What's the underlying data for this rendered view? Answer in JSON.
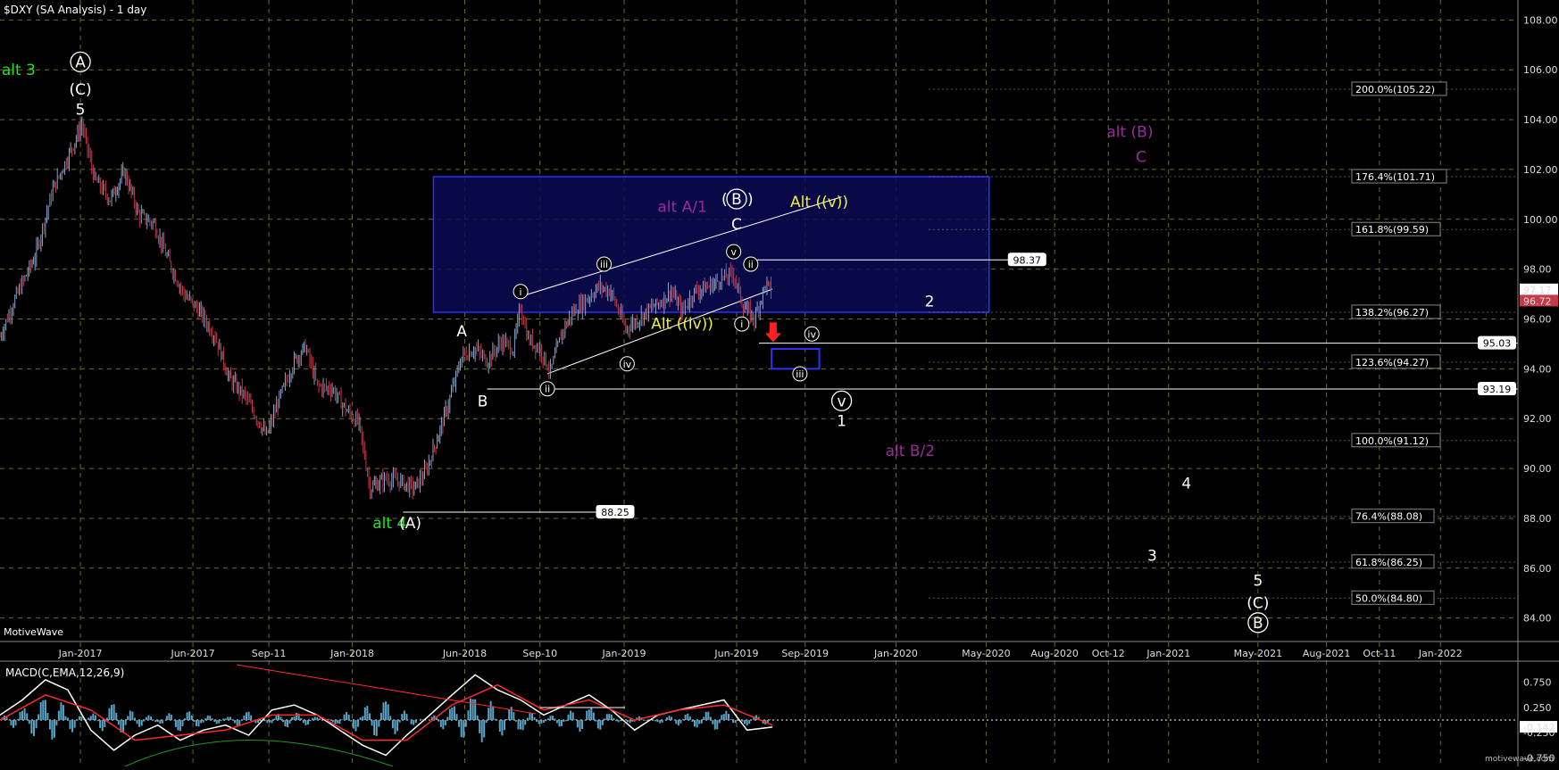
{
  "window": {
    "title": "$DXY (SA Analysis) - 1 day",
    "watermark": "MotiveWave",
    "footer_brand": "motivewave.com"
  },
  "colors": {
    "background": "#000000",
    "grid": "#6b6b2a",
    "price_up": "#8aa3c8",
    "price_down": "#c23b4a",
    "box_fill": "#0b0b55",
    "box_stroke": "#2f2fff",
    "line_white": "#ffffff",
    "label_green": "#22e622",
    "label_purple": "#9b2a9b",
    "label_yellow": "#f3f03a",
    "arrow_red": "#ff2020",
    "macd_line": "#ffffff",
    "macd_signal": "#ff2a2a",
    "macd_hist": "#5aa5c8",
    "macd_arc": "#1f9b1f"
  },
  "chart_data": [
    {
      "type": "line",
      "title": "$DXY (SA Analysis) - 1 day",
      "x_tick_labels": [
        "Jan-2017",
        "Jun-2017",
        "Sep-11",
        "Jan-2018",
        "Jun-2018",
        "Sep-10",
        "Jan-2019",
        "Jun-2019",
        "Sep-2019",
        "Jan-2020",
        "May-2020",
        "Aug-2020",
        "Oct-12",
        "Jan-2021",
        "May-2021",
        "Aug-2021",
        "Oct-11",
        "Jan-2022"
      ],
      "x_tick_dates": [
        "2017-01-01",
        "2017-06-01",
        "2017-09-11",
        "2018-01-01",
        "2018-06-01",
        "2018-09-10",
        "2019-01-01",
        "2019-06-01",
        "2019-09-01",
        "2020-01-01",
        "2020-05-01",
        "2020-08-01",
        "2020-10-12",
        "2021-01-01",
        "2021-05-01",
        "2021-08-01",
        "2021-10-11",
        "2022-01-01"
      ],
      "x_range": [
        "2016-09-15",
        "2022-04-15"
      ],
      "y_ticks": [
        84,
        86,
        88,
        90,
        92,
        94,
        96,
        98,
        100,
        102,
        104,
        106,
        108
      ],
      "y_tick_labels": [
        "84.00",
        "86.00",
        "88.00",
        "90.00",
        "92.00",
        "94.00",
        "96.00",
        "98.00",
        "100.00",
        "102.00",
        "104.00",
        "106.00",
        "108.00"
      ],
      "ylim": [
        83.2,
        108.8
      ],
      "grid": true,
      "series": [
        {
          "x": [
            "2016-09-15",
            "2016-10-05",
            "2016-11-01",
            "2016-11-25",
            "2016-12-15",
            "2017-01-03",
            "2017-01-20",
            "2017-02-10",
            "2017-03-01",
            "2017-03-20",
            "2017-04-10",
            "2017-05-01",
            "2017-05-20",
            "2017-06-10",
            "2017-07-01",
            "2017-07-20",
            "2017-08-10",
            "2017-09-08",
            "2017-09-25",
            "2017-10-15",
            "2017-10-30",
            "2017-11-15",
            "2017-12-05",
            "2017-12-25",
            "2018-01-10",
            "2018-01-25",
            "2018-02-15",
            "2018-03-05",
            "2018-03-25",
            "2018-04-10",
            "2018-04-25",
            "2018-05-10",
            "2018-05-28",
            "2018-06-15",
            "2018-07-01",
            "2018-07-20",
            "2018-08-05",
            "2018-08-15",
            "2018-08-25",
            "2018-09-10",
            "2018-09-24",
            "2018-10-10",
            "2018-10-25",
            "2018-11-12",
            "2018-11-28",
            "2018-12-14",
            "2019-01-03",
            "2019-01-20",
            "2019-02-05",
            "2019-02-20",
            "2019-03-05",
            "2019-03-20",
            "2019-04-05",
            "2019-04-25",
            "2019-05-10",
            "2019-05-28",
            "2019-06-10",
            "2019-06-25",
            "2019-07-10",
            "2019-07-19"
          ],
          "y": [
            95.3,
            96.8,
            98.5,
            101.2,
            102.5,
            103.8,
            101.6,
            100.8,
            101.9,
            100.2,
            99.8,
            98.2,
            97.0,
            96.3,
            95.3,
            93.6,
            92.9,
            91.3,
            92.8,
            94.3,
            94.9,
            93.3,
            93.2,
            92.3,
            91.8,
            89.2,
            89.6,
            89.5,
            89.2,
            89.9,
            91.2,
            92.6,
            94.5,
            94.8,
            94.3,
            95.1,
            94.8,
            96.5,
            95.2,
            94.8,
            93.9,
            95.5,
            96.3,
            96.8,
            97.3,
            97.1,
            95.6,
            96.0,
            96.4,
            96.7,
            97.1,
            96.3,
            97.1,
            97.3,
            97.6,
            97.8,
            96.5,
            96.0,
            97.4,
            97.1
          ]
        }
      ],
      "wave_labels": [
        {
          "text": "alt 3",
          "x": "2016-10-10",
          "y": 105.8,
          "color": "green"
        },
        {
          "text": "A",
          "x": "2017-01-01",
          "y": 106.1,
          "style": "circled",
          "color": "white"
        },
        {
          "text": "(C)",
          "x": "2017-01-01",
          "y": 105.0,
          "color": "white"
        },
        {
          "text": "5",
          "x": "2017-01-01",
          "y": 104.2,
          "color": "white"
        },
        {
          "text": "alt 4",
          "x": "2018-02-20",
          "y": 87.6,
          "color": "green"
        },
        {
          "text": "(A)",
          "x": "2018-03-20",
          "y": 87.6,
          "color": "white"
        },
        {
          "text": "A",
          "x": "2018-05-28",
          "y": 95.3,
          "color": "white"
        },
        {
          "text": "B",
          "x": "2018-06-25",
          "y": 92.5,
          "color": "white"
        },
        {
          "text": "alt A/1",
          "x": "2019-03-20",
          "y": 100.3,
          "color": "purple"
        },
        {
          "text": "B",
          "x": "2019-06-01",
          "y": 100.6,
          "style": "paren-circled",
          "color": "white"
        },
        {
          "text": "C",
          "x": "2019-06-01",
          "y": 99.6,
          "color": "white"
        },
        {
          "text": "Alt ((v))",
          "x": "2019-09-20",
          "y": 100.5,
          "color": "yellow"
        },
        {
          "text": "Alt ((iv))",
          "x": "2019-03-20",
          "y": 95.6,
          "color": "yellow"
        },
        {
          "text": "2",
          "x": "2020-02-15",
          "y": 96.5,
          "color": "white"
        },
        {
          "text": "alt (B)",
          "x": "2020-11-10",
          "y": 103.3,
          "color": "purple"
        },
        {
          "text": "C",
          "x": "2020-11-25",
          "y": 102.3,
          "color": "purple"
        },
        {
          "text": "v",
          "x": "2019-10-20",
          "y": 92.5,
          "style": "circled",
          "color": "white"
        },
        {
          "text": "1",
          "x": "2019-10-20",
          "y": 91.7,
          "color": "white"
        },
        {
          "text": "alt B/2",
          "x": "2020-01-20",
          "y": 90.5,
          "color": "purple"
        },
        {
          "text": "4",
          "x": "2021-01-25",
          "y": 89.2,
          "color": "white"
        },
        {
          "text": "3",
          "x": "2020-12-10",
          "y": 86.3,
          "color": "white"
        },
        {
          "text": "5",
          "x": "2021-05-01",
          "y": 85.3,
          "color": "white"
        },
        {
          "text": "(C)",
          "x": "2021-05-01",
          "y": 84.4,
          "color": "white"
        },
        {
          "text": "B",
          "x": "2021-05-01",
          "y": 83.6,
          "style": "circled",
          "color": "white"
        }
      ],
      "minor_labels": [
        {
          "text": "i",
          "x": "2018-08-15",
          "y": 97.1
        },
        {
          "text": "ii",
          "x": "2018-09-20",
          "y": 93.2
        },
        {
          "text": "iii",
          "x": "2018-12-05",
          "y": 98.2
        },
        {
          "text": "iv",
          "x": "2019-01-05",
          "y": 94.2
        },
        {
          "text": "v",
          "x": "2019-05-28",
          "y": 98.7
        },
        {
          "text": "ii",
          "x": "2019-06-20",
          "y": 98.2
        },
        {
          "text": "i",
          "x": "2019-06-08",
          "y": 95.8
        },
        {
          "text": "iv",
          "x": "2019-09-10",
          "y": 95.4
        },
        {
          "text": "iii",
          "x": "2019-08-25",
          "y": 93.8
        }
      ],
      "horizontal_levels": [
        {
          "label": "98.37",
          "value": 98.37,
          "x_start": "2019-06-20",
          "x_end": "2020-06-25"
        },
        {
          "label": "95.03",
          "value": 95.03,
          "x_start": "2019-07-01",
          "x_end": "2022-04-15"
        },
        {
          "label": "93.19",
          "value": 93.19,
          "x_start": "2018-07-01",
          "x_end": "2022-04-15"
        },
        {
          "label": "88.25",
          "value": 88.25,
          "x_start": "2018-03-10",
          "x_end": "2018-12-20"
        }
      ],
      "fib_levels": [
        {
          "label": "200.0%(105.22)",
          "value": 105.22
        },
        {
          "label": "176.4%(101.71)",
          "value": 101.71
        },
        {
          "label": "161.8%(99.59)",
          "value": 99.59
        },
        {
          "label": "138.2%(96.27)",
          "value": 96.27
        },
        {
          "label": "123.6%(94.27)",
          "value": 94.27
        },
        {
          "label": "100.0%(91.12)",
          "value": 91.12
        },
        {
          "label": "76.4%(88.08)",
          "value": 88.08
        },
        {
          "label": "61.8%(86.25)",
          "value": 86.25
        },
        {
          "label": "50.0%(84.80)",
          "value": 84.8
        }
      ],
      "target_boxes": [
        {
          "x0": "2018-04-20",
          "x1": "2020-05-05",
          "y0": 96.27,
          "y1": 101.71
        },
        {
          "x0": "2019-07-18",
          "x1": "2019-09-20",
          "y0": 94.0,
          "y1": 94.8
        }
      ],
      "channel_lines": [
        {
          "x0": "2018-08-15",
          "y0": 96.9,
          "x1": "2019-10-20",
          "y1": 100.9
        },
        {
          "x0": "2018-09-20",
          "y0": 93.8,
          "x1": "2019-07-19",
          "y1": 97.2
        }
      ],
      "price_tags": [
        {
          "label": "97.17",
          "value": 97.17,
          "kind": "last-close"
        },
        {
          "label": "96.72",
          "value": 96.72,
          "kind": "current"
        }
      ],
      "arrow": {
        "direction": "down",
        "x": "2019-07-20",
        "y": 95.0
      }
    },
    {
      "type": "line",
      "title": "MACD(C,EMA,12,26,9)",
      "ylim": [
        -0.85,
        1.1
      ],
      "y_ticks": [
        0.75,
        0.25,
        -0.25,
        -0.75
      ],
      "y_tick_labels": [
        "0.750",
        "0.250",
        "-0.250",
        "-0.750"
      ],
      "zero_dotted": 0.0,
      "current_value_label": "-0.142",
      "current_value": -0.142,
      "series": [
        {
          "name": "MACD",
          "x": [
            "2016-09-15",
            "2016-10-15",
            "2016-11-15",
            "2016-12-15",
            "2017-01-15",
            "2017-02-15",
            "2017-03-15",
            "2017-04-15",
            "2017-05-15",
            "2017-06-15",
            "2017-07-15",
            "2017-08-15",
            "2017-09-15",
            "2017-10-15",
            "2017-11-15",
            "2017-12-15",
            "2018-01-15",
            "2018-02-15",
            "2018-03-15",
            "2018-04-15",
            "2018-05-15",
            "2018-06-15",
            "2018-07-15",
            "2018-08-15",
            "2018-09-15",
            "2018-10-15",
            "2018-11-15",
            "2018-12-15",
            "2019-01-15",
            "2019-02-15",
            "2019-03-15",
            "2019-04-15",
            "2019-05-15",
            "2019-06-15",
            "2019-07-19"
          ],
          "y": [
            0.1,
            0.4,
            0.8,
            0.6,
            -0.2,
            -0.6,
            -0.3,
            -0.1,
            -0.4,
            -0.2,
            -0.1,
            -0.3,
            0.2,
            0.3,
            0.1,
            -0.2,
            -0.5,
            -0.7,
            -0.3,
            0.1,
            0.5,
            0.9,
            0.6,
            0.4,
            0.1,
            0.3,
            0.5,
            0.2,
            -0.2,
            0.1,
            0.2,
            0.3,
            0.4,
            -0.2,
            -0.14
          ]
        },
        {
          "name": "Signal",
          "x": [
            "2016-09-15",
            "2016-11-15",
            "2017-01-15",
            "2017-03-15",
            "2017-05-15",
            "2017-07-15",
            "2017-09-15",
            "2017-11-15",
            "2018-01-15",
            "2018-03-15",
            "2018-05-15",
            "2018-07-15",
            "2018-09-15",
            "2018-11-15",
            "2019-01-15",
            "2019-03-15",
            "2019-05-15",
            "2019-07-19"
          ],
          "y": [
            0.0,
            0.5,
            0.2,
            -0.4,
            -0.3,
            -0.2,
            0.1,
            0.1,
            -0.4,
            -0.4,
            0.3,
            0.7,
            0.2,
            0.4,
            0.0,
            0.2,
            0.3,
            -0.1
          ]
        }
      ]
    }
  ]
}
